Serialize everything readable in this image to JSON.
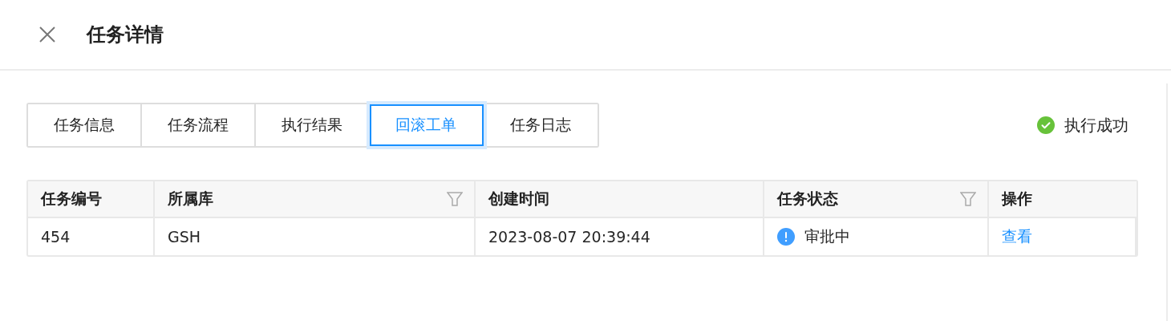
{
  "header": {
    "title": "任务详情"
  },
  "tabs": [
    {
      "label": "任务信息",
      "selected": false
    },
    {
      "label": "任务流程",
      "selected": false
    },
    {
      "label": "执行结果",
      "selected": false
    },
    {
      "label": "回滚工单",
      "selected": true
    },
    {
      "label": "任务日志",
      "selected": false
    }
  ],
  "result": {
    "kind": "success",
    "text": "执行成功"
  },
  "table": {
    "columns": [
      {
        "label": "任务编号",
        "filterable": false
      },
      {
        "label": "所属库",
        "filterable": true
      },
      {
        "label": "创建时间",
        "filterable": false
      },
      {
        "label": "任务状态",
        "filterable": true
      },
      {
        "label": "操作",
        "filterable": false
      }
    ],
    "rows": [
      {
        "id": "454",
        "database": "GSH",
        "created": "2023-08-07 20:39:44",
        "status": {
          "kind": "info",
          "text": "审批中"
        },
        "action": "查看"
      }
    ]
  }
}
